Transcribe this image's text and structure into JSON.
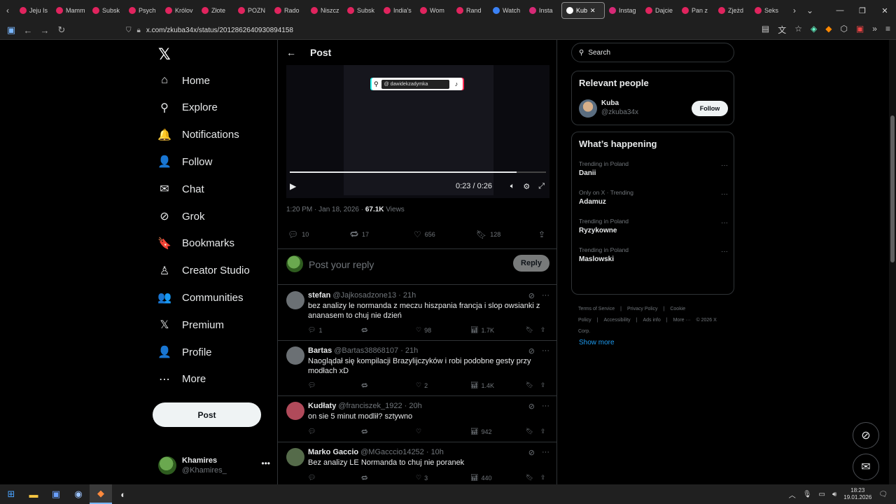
{
  "browser": {
    "tabs": [
      {
        "label": "Jeju Is",
        "favicon": "#e0245e"
      },
      {
        "label": "Mamm",
        "favicon": "#e0245e"
      },
      {
        "label": "Subsk",
        "favicon": "#e0245e"
      },
      {
        "label": "Psych",
        "favicon": "#e0245e"
      },
      {
        "label": "Królov",
        "favicon": "#e0245e"
      },
      {
        "label": "Złote",
        "favicon": "#e0245e"
      },
      {
        "label": "POZN",
        "favicon": "#e0245e"
      },
      {
        "label": "Rado",
        "favicon": "#e0245e"
      },
      {
        "label": "Niszcz",
        "favicon": "#e0245e"
      },
      {
        "label": "Subsk",
        "favicon": "#e0245e"
      },
      {
        "label": "India's",
        "favicon": "#e0245e"
      },
      {
        "label": "Wom",
        "favicon": "#e0245e"
      },
      {
        "label": "Rand",
        "favicon": "#e0245e"
      },
      {
        "label": "Watch",
        "favicon": "#3b82f6"
      },
      {
        "label": "Insta",
        "favicon": "#d62976"
      },
      {
        "label": "Kub",
        "favicon": "#ffffff",
        "active": true
      },
      {
        "label": "Instag",
        "favicon": "#d62976"
      },
      {
        "label": "Dajcie",
        "favicon": "#e0245e"
      },
      {
        "label": "Pan z",
        "favicon": "#e0245e"
      },
      {
        "label": "Zjeżd",
        "favicon": "#e0245e"
      },
      {
        "label": "Seks",
        "favicon": "#e0245e"
      }
    ],
    "url": "x.com/zkuba34x/status/2012862640930894158"
  },
  "nav": {
    "items": [
      {
        "label": "Home",
        "icon": "home-icon",
        "glyph": "⌂"
      },
      {
        "label": "Explore",
        "icon": "search-icon",
        "glyph": "⚲"
      },
      {
        "label": "Notifications",
        "icon": "bell-icon",
        "glyph": "🔔"
      },
      {
        "label": "Follow",
        "icon": "person-add-icon",
        "glyph": "👤"
      },
      {
        "label": "Chat",
        "icon": "mail-icon",
        "glyph": "✉"
      },
      {
        "label": "Grok",
        "icon": "grok-icon",
        "glyph": "⊘"
      },
      {
        "label": "Bookmarks",
        "icon": "bookmark-icon",
        "glyph": "🔖"
      },
      {
        "label": "Creator Studio",
        "icon": "creator-icon",
        "glyph": "♙"
      },
      {
        "label": "Communities",
        "icon": "communities-icon",
        "glyph": "👥"
      },
      {
        "label": "Premium",
        "icon": "x-icon",
        "glyph": "𝕏"
      },
      {
        "label": "Profile",
        "icon": "profile-icon",
        "glyph": "👤"
      },
      {
        "label": "More",
        "icon": "more-circle-icon",
        "glyph": "⋯"
      }
    ],
    "post_label": "Post",
    "account": {
      "display_name": "Khamires",
      "handle": "@Khamires_"
    }
  },
  "header": {
    "title": "Post"
  },
  "video": {
    "tag": "@ dawidekzadymka",
    "progress": 0.884,
    "time": "0:23 / 0:26"
  },
  "post": {
    "meta_time": "1:20 PM · Jan 18, 2026 · ",
    "views_count": "67.1K",
    "views_label": " Views",
    "stats": {
      "replies": "10",
      "reposts": "17",
      "likes": "656",
      "bookmarks": "128"
    }
  },
  "reply_box": {
    "placeholder": "Post your reply",
    "button": "Reply"
  },
  "replies": [
    {
      "name": "stefan",
      "handle": "@Jajkosadzone13 · 21h",
      "text": "bez analizy le normanda z meczu hiszpania francja i slop owsianki z ananasem to chuj nie dzień",
      "replies": "1",
      "reposts": "",
      "likes": "98",
      "views": "1.7K",
      "avatar": "#6b7074"
    },
    {
      "name": "Bartas",
      "handle": "@Bartas38868107 · 21h",
      "text": "Naoglądał się kompilacji Brazylijczyków i robi podobne gesty przy modłach xD",
      "replies": "",
      "reposts": "",
      "likes": "2",
      "views": "1.4K",
      "avatar": "#6b7074"
    },
    {
      "name": "Kudłaty",
      "handle": "@franciszek_1922 · 20h",
      "text": "on sie 5 minut modlił? sztywno",
      "replies": "",
      "reposts": "",
      "likes": "",
      "views": "942",
      "avatar": "#b04a5a"
    },
    {
      "name": "Marko Gaccio",
      "handle": "@MGacccio14252 · 10h",
      "text": "Bez analizy LE Normanda to chuj nie poranek",
      "replies": "",
      "reposts": "",
      "likes": "3",
      "views": "440",
      "avatar": "#556b4a"
    }
  ],
  "right": {
    "search_placeholder": "Search",
    "relevant_title": "Relevant people",
    "person": {
      "name": "Kuba",
      "handle": "@zkuba34x",
      "follow": "Follow"
    },
    "happening_title": "What’s happening",
    "trends": [
      {
        "context": "Trending in Poland",
        "name": "Danii"
      },
      {
        "context": "Only on X · Trending",
        "name": "Adamuz"
      },
      {
        "context": "Trending in Poland",
        "name": "Ryzykowne"
      },
      {
        "context": "Trending in Poland",
        "name": "Maslowski"
      }
    ],
    "show_more": "Show more",
    "footer": [
      "Terms of Service",
      "|",
      "Privacy Policy",
      "|",
      "Cookie Policy",
      "|",
      "Accessibility",
      "|",
      "Ads info",
      "|",
      "More ···",
      "© 2026 X Corp."
    ]
  },
  "taskbar": {
    "time": "18:23",
    "date": "19.01.2026"
  },
  "colors": {
    "accent": "#1d9bf0",
    "background": "#000000",
    "border": "#2f3336",
    "muted": "#71767b"
  }
}
